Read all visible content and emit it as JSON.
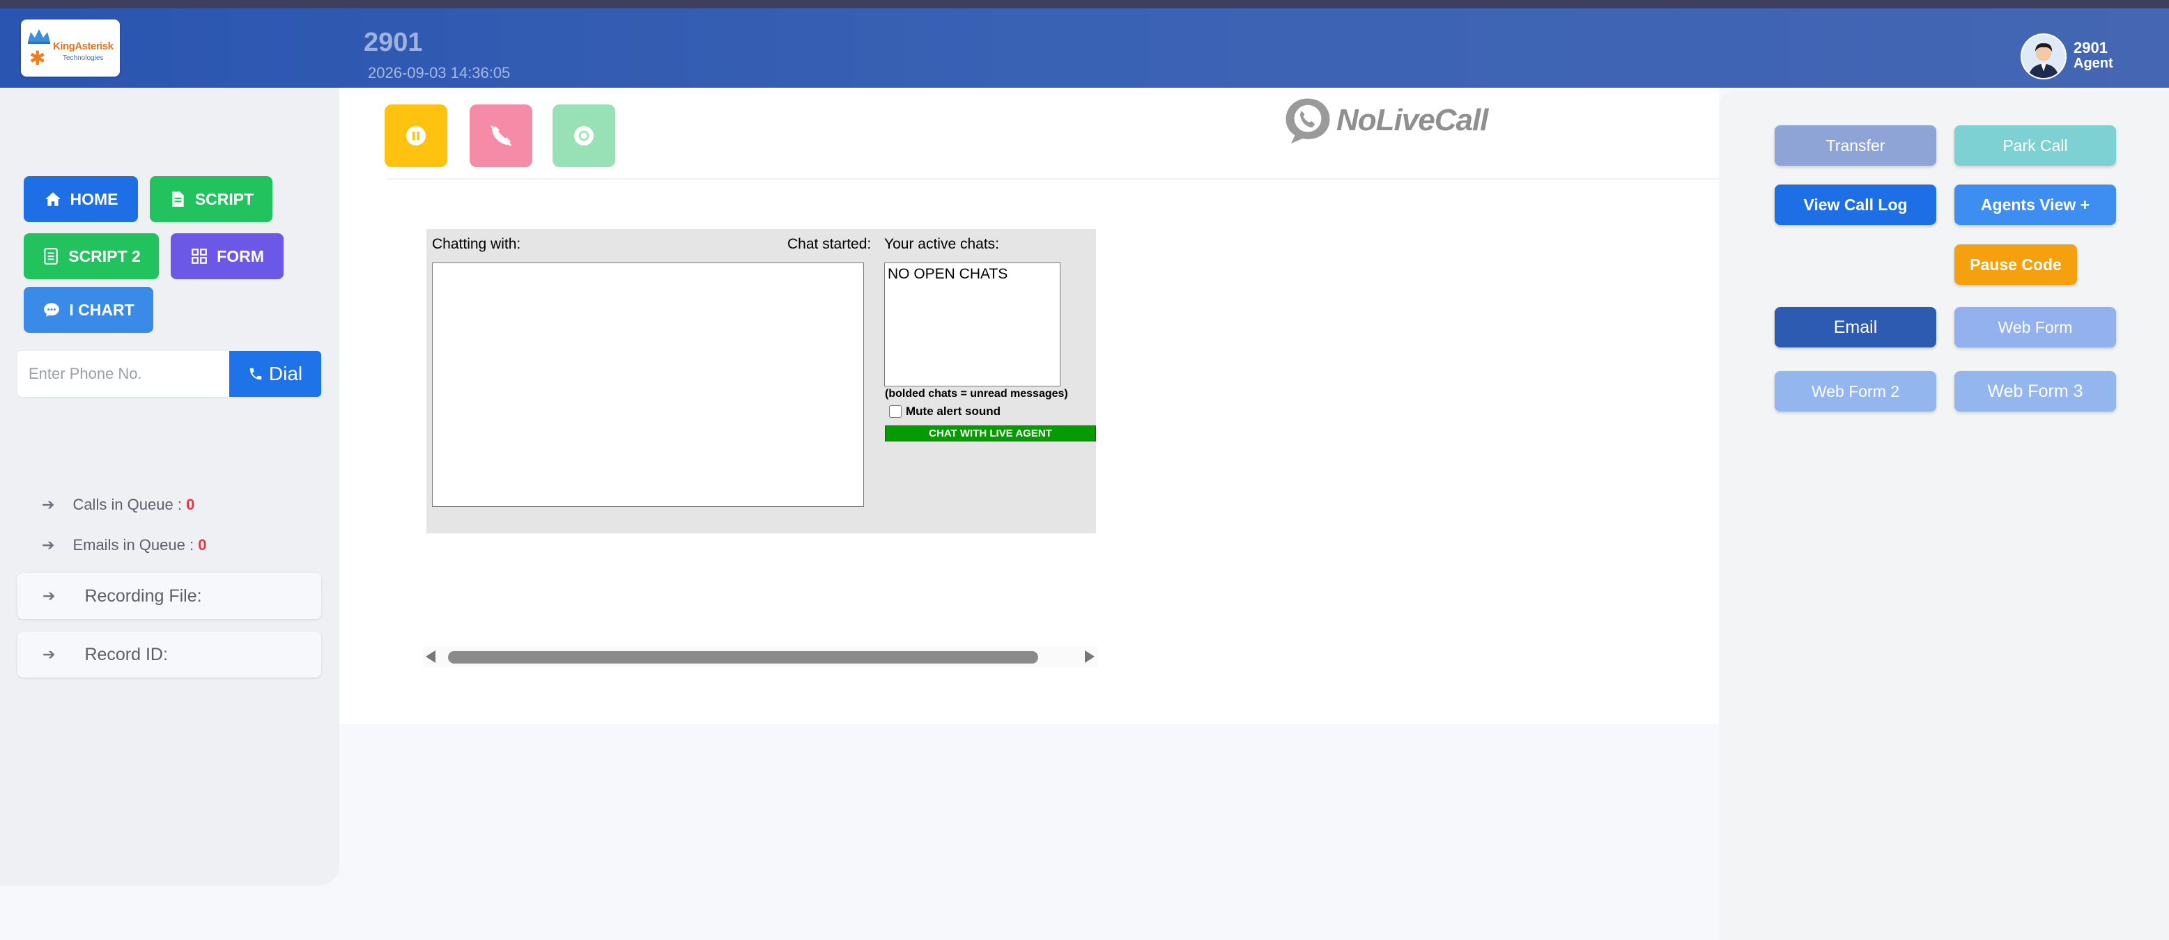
{
  "header": {
    "logo": {
      "brand": "KingAsterisk",
      "tagline": "Technologies"
    },
    "agent_extension": "2901",
    "datetime": "2026-09-03 14:36:05",
    "user": {
      "name": "2901",
      "role": "Agent"
    }
  },
  "sidebar": {
    "nav": {
      "home": "HOME",
      "script": "SCRIPT",
      "script2": "SCRIPT 2",
      "form": "FORM",
      "ichart": "I CHART"
    },
    "dial": {
      "placeholder": "Enter Phone No.",
      "button": "Dial"
    },
    "calls_in_queue": {
      "label": "Calls in Queue :",
      "value": "0"
    },
    "emails_in_queue": {
      "label": "Emails in Queue :",
      "value": "0"
    },
    "recording_file": "Recording File:",
    "record_id": "Record ID:"
  },
  "main": {
    "branding": "NoLiveCall",
    "chat": {
      "chatting_with": "Chatting with:",
      "chat_started": "Chat started:",
      "active_chats": "Your active chats:",
      "no_open_chats": "NO OPEN CHATS",
      "bold_note": "(bolded chats = unread messages)",
      "mute_label": "Mute alert sound",
      "live_agent_button": "CHAT WITH LIVE AGENT"
    }
  },
  "right_panel": {
    "transfer": "Transfer",
    "park_call": "Park Call",
    "view_call_log": "View Call Log",
    "agents_view": "Agents View +",
    "pause_code": "Pause Code",
    "email": "Email",
    "web_form": "Web Form",
    "web_form_2": "Web Form 2",
    "web_form_3": "Web Form 3"
  },
  "colors": {
    "header": "#2a55b0",
    "primary_blue": "#1e6fe6",
    "green": "#22c25e",
    "purple": "#6b58e6",
    "pause_yellow": "#ffc20f",
    "hangup_pink": "#f58ba6",
    "record_green": "#98e0b5",
    "live_agent_green": "#049c00",
    "queue_count_red": "#ee3344"
  },
  "icons": {
    "home": "home-icon",
    "script": "document-icon",
    "script2": "list-document-icon",
    "form": "grid-icon",
    "ichart": "chat-bubble-icon",
    "dial": "phone-icon",
    "pause": "pause-icon",
    "hangup": "hangup-icon",
    "record": "record-icon"
  }
}
